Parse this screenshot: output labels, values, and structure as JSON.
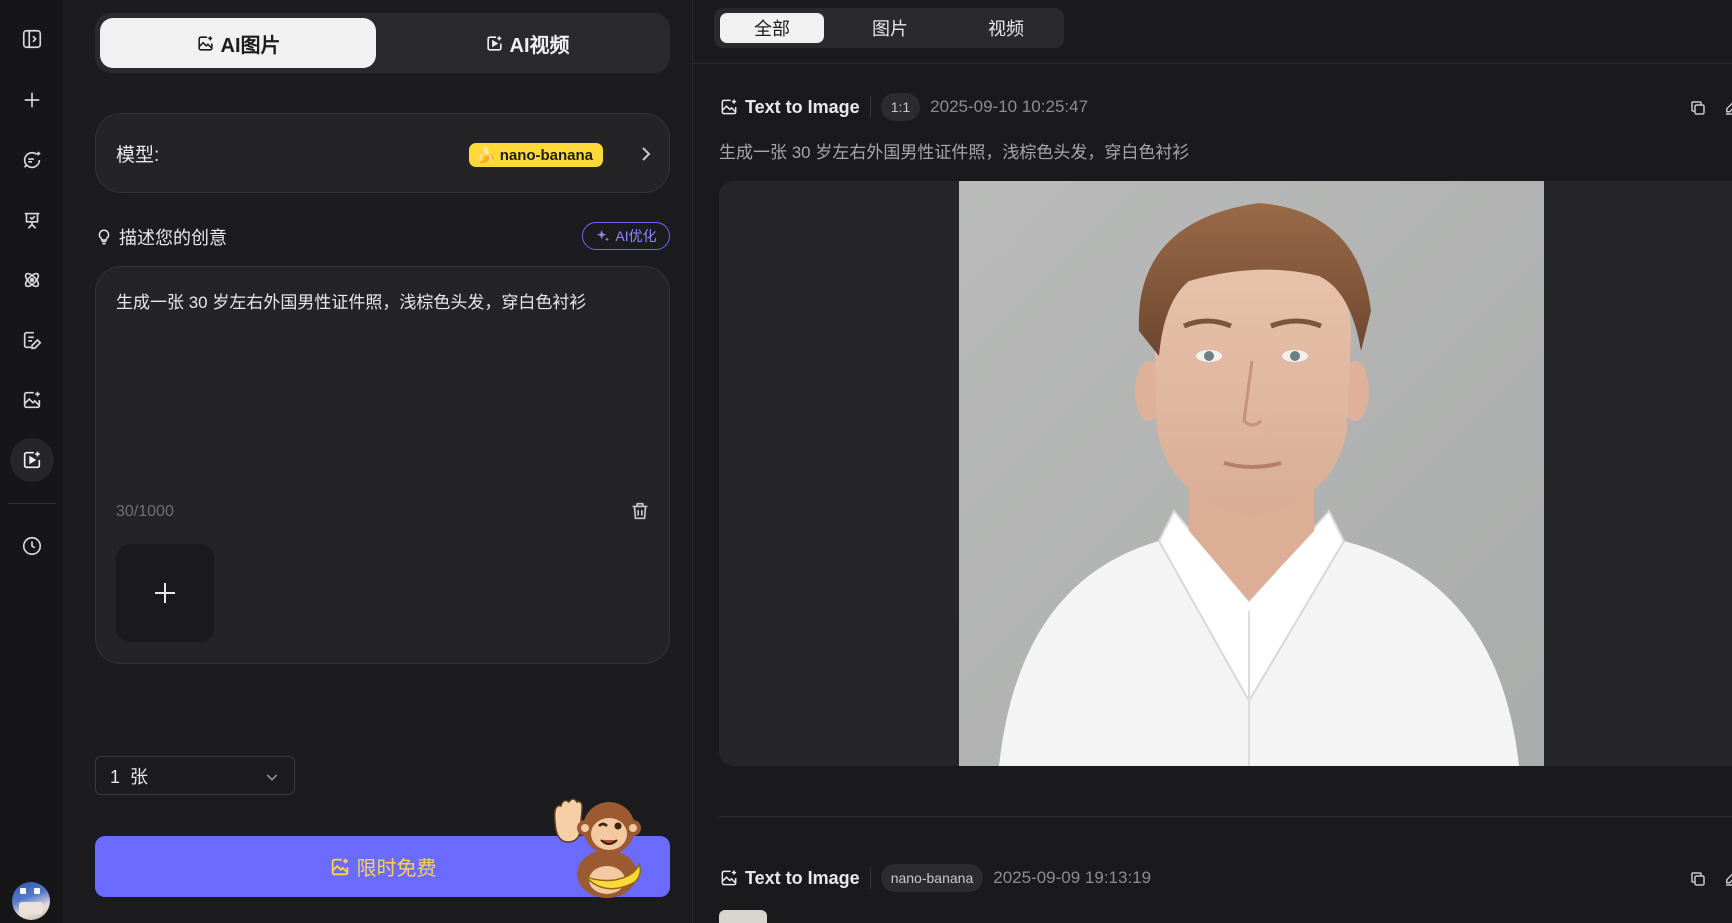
{
  "colors": {
    "accent": "#6c6bff",
    "badge_yellow": "#ffd93a",
    "cta_text": "#ffd24a",
    "bg": "#1a1a1c"
  },
  "rail": {
    "icons": [
      "sidebar-toggle-icon",
      "new-chat-icon",
      "chat-sparkle-icon",
      "presentation-icon",
      "atom-icon",
      "edit-doc-icon",
      "image-sparkle-icon",
      "media-create-icon",
      "history-icon"
    ],
    "active_index": 7
  },
  "mode_switch": {
    "image_label": "AI图片",
    "video_label": "AI视频",
    "selected": "image"
  },
  "model": {
    "label": "模型:",
    "value": "nano-banana",
    "emoji": "🍌"
  },
  "description": {
    "label": "描述您的创意",
    "ai_optimize_label": "AI优化"
  },
  "prompt": {
    "value": "生成一张 30 岁左右外国男性证件照，浅棕色头发，穿白色衬衫",
    "char_count": "30/1000"
  },
  "image_count": {
    "value": "1  张"
  },
  "generate": {
    "label": "限时免费"
  },
  "filters": {
    "tabs": [
      "全部",
      "图片",
      "视频"
    ],
    "active": "全部"
  },
  "results": [
    {
      "type_label": "Text to Image",
      "chip": "1:1",
      "timestamp": "2025-09-10 10:25:47",
      "prompt": "生成一张 30 岁左右外国男性证件照，浅棕色头发，穿白色衬衫"
    },
    {
      "type_label": "Text to Image",
      "chip": "nano-banana",
      "timestamp": "2025-09-09 19:13:19"
    }
  ]
}
